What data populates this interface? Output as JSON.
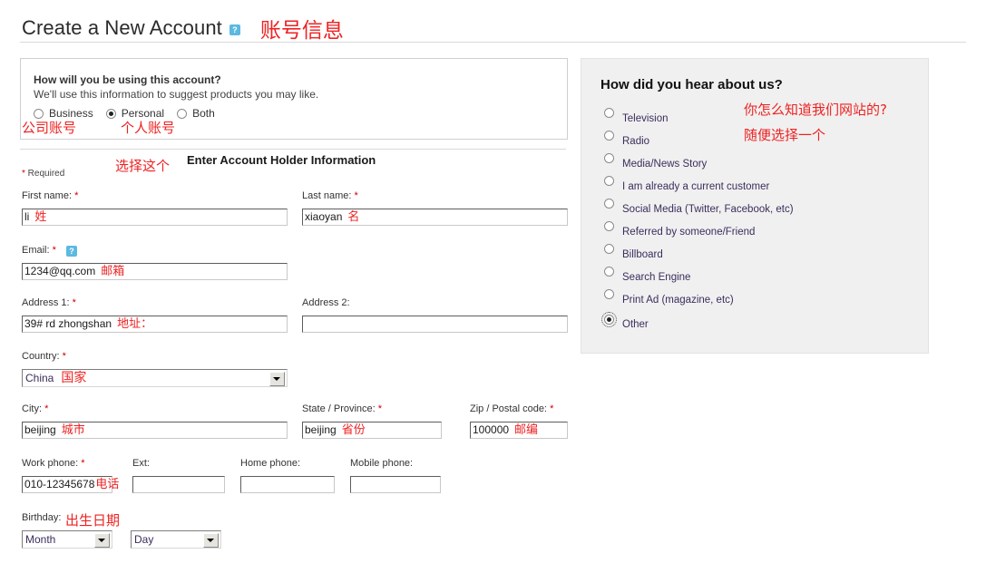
{
  "header": {
    "title": "Create a New Account",
    "help_icon": "help-question-icon",
    "annotation": "账号信息"
  },
  "usage_box": {
    "question": "How will you be using this account?",
    "subtext": "We'll use this information to suggest products you may like.",
    "options": [
      {
        "label": "Business",
        "checked": false,
        "annotation": "公司账号"
      },
      {
        "label": "Personal",
        "checked": true,
        "annotation": "个人账号"
      },
      {
        "label": "Both",
        "checked": false,
        "annotation": ""
      }
    ]
  },
  "section": {
    "title": "Enter Account Holder Information",
    "annotation": "选择这个",
    "required_star": "*",
    "required_text": " Required"
  },
  "form": {
    "first_name": {
      "label": "First name:",
      "required": "*",
      "value": "li",
      "annotation": "姓"
    },
    "last_name": {
      "label": "Last name:",
      "required": "*",
      "value": "xiaoyan",
      "annotation": "名"
    },
    "email": {
      "label": "Email:",
      "required": "*",
      "value": "1234@qq.com",
      "annotation": "邮箱",
      "help_icon": "help-question-icon"
    },
    "address1": {
      "label": "Address 1:",
      "required": "*",
      "value": "39# rd zhongshan",
      "annotation": "地址："
    },
    "address2": {
      "label": "Address 2:",
      "required": "",
      "value": "",
      "annotation": ""
    },
    "country": {
      "label": "Country:",
      "required": "*",
      "value": "China",
      "annotation": "国家"
    },
    "city": {
      "label": "City:",
      "required": "*",
      "value": "beijing",
      "annotation": "城市"
    },
    "state": {
      "label": "State / Province:",
      "required": "*",
      "value": "beijing",
      "annotation": "省份"
    },
    "zip": {
      "label": "Zip / Postal code:",
      "required": "*",
      "value": "100000",
      "annotation": "邮编"
    },
    "work_phone": {
      "label": "Work phone:",
      "required": "*",
      "value": "010-12345678",
      "annotation": "电话"
    },
    "ext": {
      "label": "Ext:",
      "required": "",
      "value": "",
      "annotation": ""
    },
    "home_phone": {
      "label": "Home phone:",
      "required": "",
      "value": "",
      "annotation": ""
    },
    "mobile_phone": {
      "label": "Mobile phone:",
      "required": "",
      "value": "",
      "annotation": ""
    },
    "birthday": {
      "label": "Birthday:",
      "annotation": "出生日期",
      "month_value": "Month",
      "day_value": "Day"
    }
  },
  "hear_panel": {
    "title": "How did you hear about us?",
    "annotation_1": "你怎么知道我们网站的?",
    "annotation_2": "随便选择一个",
    "options": [
      {
        "label": "Television",
        "checked": false
      },
      {
        "label": "Radio",
        "checked": false
      },
      {
        "label": "Media/News Story",
        "checked": false
      },
      {
        "label": "I am already a current customer",
        "checked": false
      },
      {
        "label": "Social Media (Twitter, Facebook, etc)",
        "checked": false
      },
      {
        "label": "Referred by someone/Friend",
        "checked": false
      },
      {
        "label": "Billboard",
        "checked": false
      },
      {
        "label": "Search Engine",
        "checked": false
      },
      {
        "label": "Print Ad (magazine, etc)",
        "checked": false
      },
      {
        "label": "Other",
        "checked": true
      }
    ]
  },
  "colors": {
    "annotation_red": "#ee2222",
    "help_blue": "#5cb9e0",
    "panel_gray": "#f0f0f0",
    "required_red": "#cc0000"
  }
}
